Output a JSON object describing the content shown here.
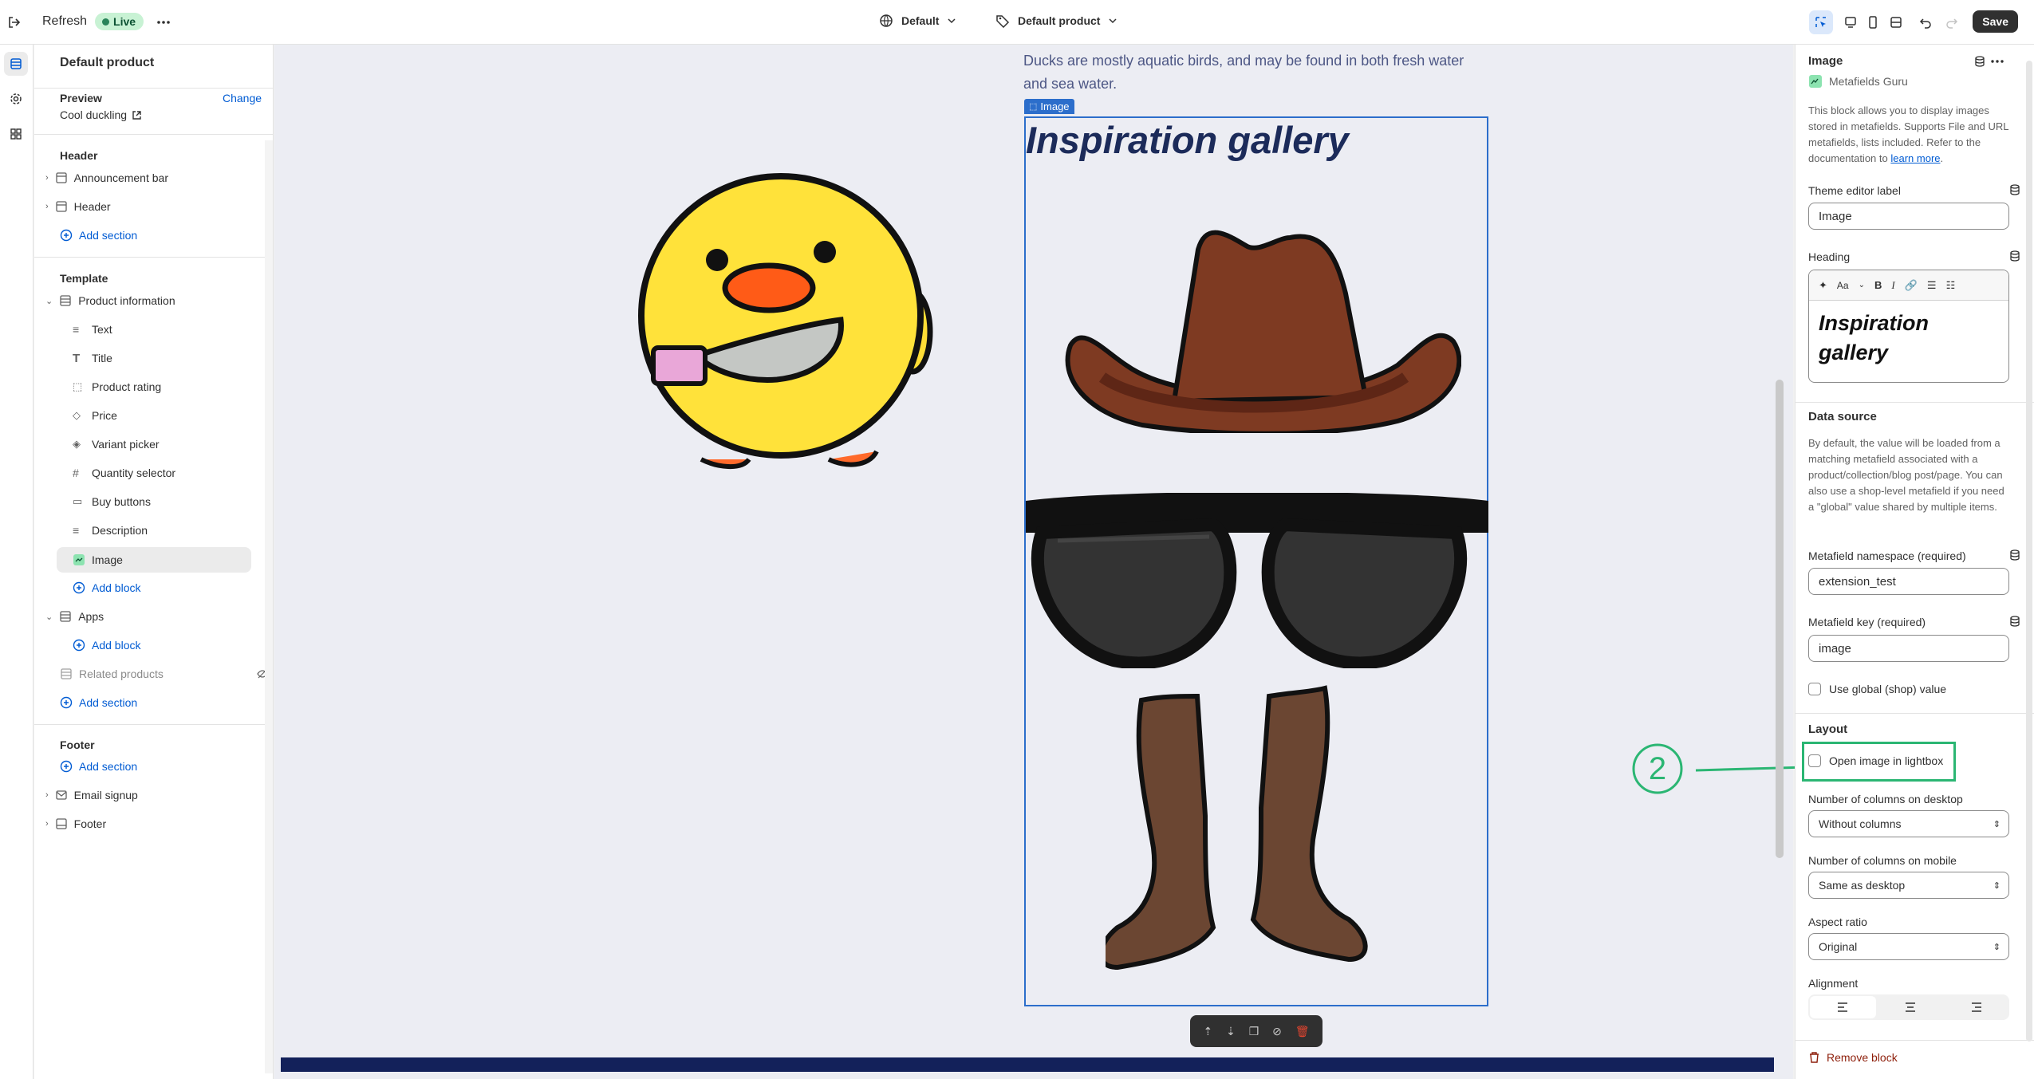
{
  "topbar": {
    "refresh_label": "Refresh",
    "live_label": "Live",
    "theme_label": "Default",
    "template_label": "Default product",
    "save_label": "Save"
  },
  "left_panel": {
    "title": "Default product",
    "preview_label": "Preview",
    "change_label": "Change",
    "preview_product": "Cool duckling",
    "header_group": "Header",
    "header_items": [
      "Announcement bar",
      "Header"
    ],
    "add_section": "Add section",
    "template_group": "Template",
    "product_info": "Product information",
    "blocks": [
      "Text",
      "Title",
      "Product rating",
      "Price",
      "Variant picker",
      "Quantity selector",
      "Buy buttons",
      "Description",
      "Image"
    ],
    "add_block": "Add block",
    "apps": "Apps",
    "related_products": "Related products",
    "footer_group": "Footer",
    "footer_items": [
      "Email signup",
      "Footer"
    ]
  },
  "canvas": {
    "description_text": "Ducks are mostly aquatic birds, and may be found in both fresh water and sea water.",
    "image_tag": "Image",
    "gallery_heading": "Inspiration gallery",
    "annotation_number": "2"
  },
  "right_panel": {
    "title": "Image",
    "app_name": "Metafields Guru",
    "intro_text": "This block allows you to display images stored in metafields. Supports File and URL metafields, lists included. Refer to the documentation to",
    "learn_more": "learn more",
    "intro_end": ".",
    "editor_label_title": "Theme editor label",
    "editor_label_value": "Image",
    "heading_title": "Heading",
    "heading_value": "Inspiration gallery",
    "rte_font_label": "Aa",
    "data_source_title": "Data source",
    "data_source_text": "By default, the value will be loaded from a matching metafield associated with a product/collection/blog post/page. You can also use a shop-level metafield if you need a \"global\" value shared by multiple items.",
    "namespace_label": "Metafield namespace (required)",
    "namespace_value": "extension_test",
    "key_label": "Metafield key (required)",
    "key_value": "image",
    "global_label": "Use global (shop) value",
    "layout_title": "Layout",
    "lightbox_label": "Open image in lightbox",
    "cols_desktop_label": "Number of columns on desktop",
    "cols_desktop_value": "Without columns",
    "cols_mobile_label": "Number of columns on mobile",
    "cols_mobile_value": "Same as desktop",
    "aspect_label": "Aspect ratio",
    "aspect_value": "Original",
    "alignment_label": "Alignment",
    "remove_label": "Remove block"
  },
  "colors": {
    "accent": "#005bd3",
    "selection_blue": "#2c6ecb",
    "annotation_green": "#2bb673",
    "heading_navy": "#1c2b5a",
    "remove_red": "#8e1f0b"
  }
}
